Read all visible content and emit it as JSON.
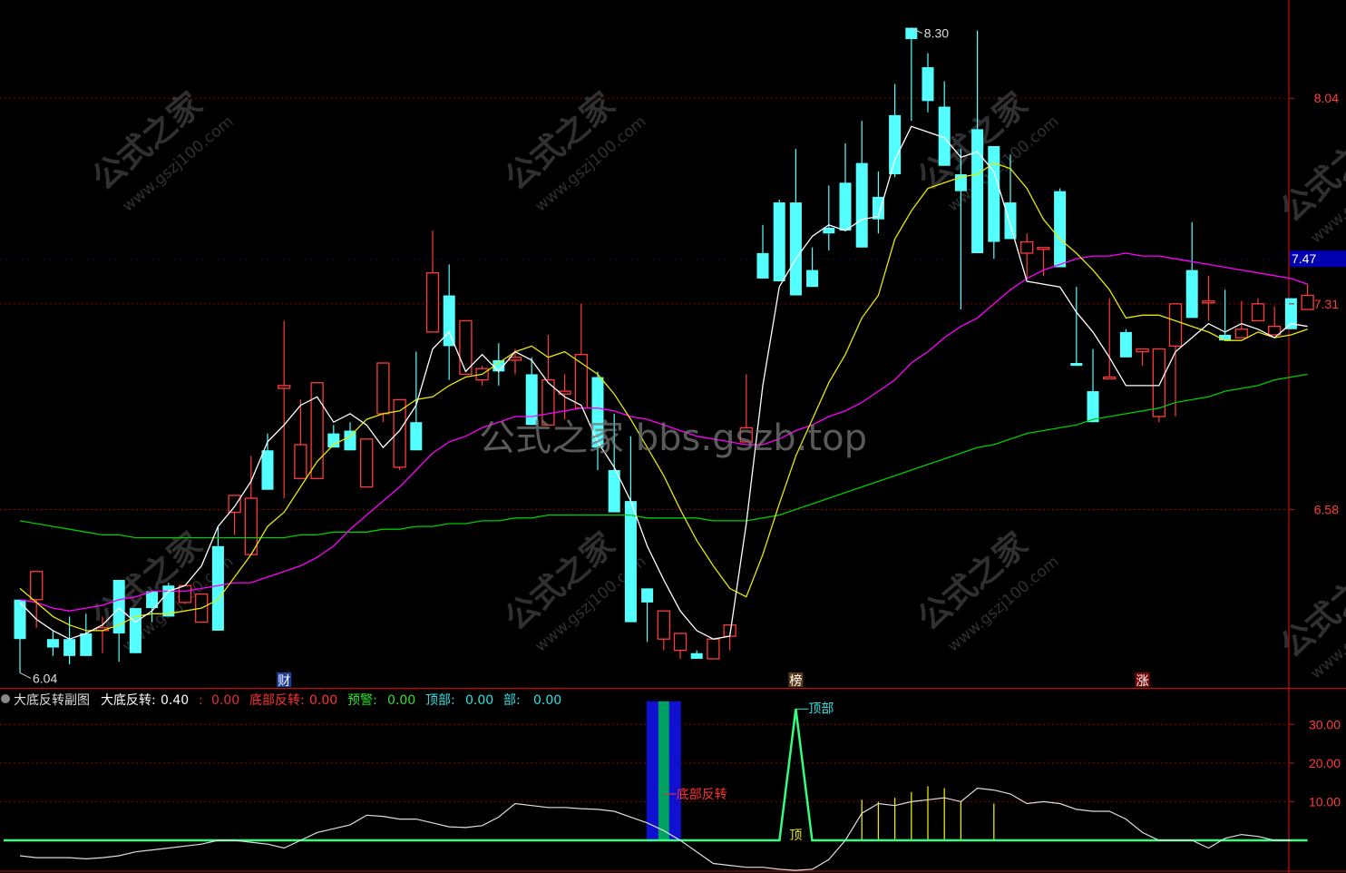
{
  "chart_data": {
    "type": "candlestick",
    "main": {
      "price_min": 5.95,
      "price_max": 8.35,
      "y_ticks": [
        "8.04",
        "7.31",
        "6.58"
      ],
      "current_price_label": "7.47",
      "high_marker": "8.30",
      "low_marker": "6.04",
      "candles": [
        [
          6.26,
          6.25,
          6.0,
          6.12
        ],
        [
          6.26,
          6.36,
          6.16,
          6.36
        ],
        [
          6.12,
          6.15,
          6.06,
          6.09
        ],
        [
          6.12,
          6.2,
          6.03,
          6.06
        ],
        [
          6.14,
          6.21,
          6.09,
          6.06
        ],
        [
          6.15,
          6.2,
          6.07,
          6.16
        ],
        [
          6.33,
          6.33,
          6.04,
          6.14
        ],
        [
          6.23,
          6.23,
          6.12,
          6.07
        ],
        [
          6.29,
          6.28,
          6.18,
          6.23
        ],
        [
          6.31,
          6.32,
          6.22,
          6.2
        ],
        [
          6.25,
          6.3,
          6.26,
          6.31
        ],
        [
          6.18,
          6.26,
          6.26,
          6.28
        ],
        [
          6.45,
          6.52,
          6.36,
          6.15
        ],
        [
          6.57,
          6.49,
          6.51,
          6.63
        ],
        [
          6.42,
          6.77,
          6.61,
          6.62
        ],
        [
          6.79,
          6.85,
          6.67,
          6.65
        ],
        [
          7.01,
          7.25,
          6.62,
          7.02
        ],
        [
          6.69,
          6.86,
          6.97,
          6.81
        ],
        [
          6.69,
          6.92,
          6.86,
          7.03
        ],
        [
          6.85,
          6.88,
          6.88,
          6.8
        ],
        [
          6.86,
          6.89,
          6.88,
          6.79
        ],
        [
          6.66,
          6.79,
          6.75,
          6.83
        ],
        [
          6.92,
          6.92,
          6.89,
          7.1
        ],
        [
          6.73,
          6.78,
          6.72,
          6.97
        ],
        [
          6.89,
          7.14,
          6.85,
          6.79
        ],
        [
          7.21,
          7.57,
          7.44,
          7.42
        ],
        [
          7.34,
          7.45,
          7.04,
          7.16
        ],
        [
          7.06,
          7.06,
          7.12,
          7.25
        ],
        [
          7.04,
          7.09,
          7.02,
          7.08
        ],
        [
          7.11,
          7.17,
          7.02,
          7.07
        ],
        [
          7.11,
          7.15,
          7.06,
          7.12
        ],
        [
          7.06,
          7.12,
          7.07,
          6.88
        ],
        [
          6.88,
          7.2,
          7.03,
          7.04
        ],
        [
          6.99,
          7.06,
          6.9,
          7.0
        ],
        [
          6.94,
          7.31,
          7.15,
          7.13
        ],
        [
          7.05,
          7.07,
          6.72,
          6.8
        ],
        [
          6.72,
          6.92,
          6.86,
          6.57
        ],
        [
          6.61,
          6.84,
          6.6,
          6.18
        ],
        [
          6.3,
          6.11,
          6.11,
          6.25
        ],
        [
          6.12,
          6.08,
          6.08,
          6.22
        ],
        [
          6.08,
          6.05,
          6.05,
          6.14
        ],
        [
          6.07,
          6.08,
          6.06,
          6.05
        ],
        [
          6.05,
          6.05,
          6.05,
          6.12
        ],
        [
          6.13,
          6.08,
          6.12,
          6.17
        ],
        [
          6.82,
          7.06,
          7.06,
          6.87
        ],
        [
          7.49,
          7.59,
          7.58,
          7.4
        ],
        [
          7.67,
          7.68,
          7.58,
          7.39
        ],
        [
          7.67,
          7.86,
          7.35,
          7.34
        ],
        [
          7.43,
          7.51,
          7.48,
          7.37
        ],
        [
          7.58,
          7.73,
          7.5,
          7.56
        ],
        [
          7.74,
          7.88,
          7.65,
          7.57
        ],
        [
          7.81,
          7.96,
          7.51,
          7.51
        ],
        [
          7.69,
          7.78,
          7.56,
          7.61
        ],
        [
          7.98,
          8.09,
          7.76,
          7.77
        ],
        [
          8.29,
          8.28,
          7.96,
          8.25
        ],
        [
          8.15,
          8.2,
          7.99,
          8.03
        ],
        [
          8.01,
          8.1,
          7.83,
          7.8
        ],
        [
          7.77,
          7.86,
          7.29,
          7.71
        ],
        [
          7.93,
          8.28,
          7.61,
          7.49
        ],
        [
          7.87,
          7.81,
          7.47,
          7.53
        ],
        [
          7.67,
          7.84,
          7.55,
          7.54
        ],
        [
          7.49,
          7.56,
          7.4,
          7.53
        ],
        [
          7.51,
          7.49,
          7.41,
          7.51
        ],
        [
          7.71,
          7.72,
          7.57,
          7.44
        ],
        [
          7.1,
          7.37,
          7.09,
          7.09
        ],
        [
          7.0,
          7.15,
          7.02,
          6.89
        ],
        [
          7.05,
          7.33,
          7.11,
          7.05
        ],
        [
          7.21,
          7.22,
          7.14,
          7.12
        ],
        [
          7.14,
          7.1,
          7.09,
          7.15
        ],
        [
          6.91,
          7.12,
          6.89,
          7.15
        ],
        [
          7.16,
          7.21,
          6.91,
          7.31
        ],
        [
          7.43,
          7.6,
          7.45,
          7.26
        ],
        [
          7.32,
          7.41,
          7.25,
          7.32
        ],
        [
          7.2,
          7.36,
          7.21,
          7.18
        ],
        [
          7.19,
          7.32,
          7.23,
          7.22
        ],
        [
          7.25,
          7.33,
          7.27,
          7.31
        ],
        [
          7.2,
          7.3,
          7.25,
          7.23
        ],
        [
          7.33,
          7.33,
          7.31,
          7.22
        ],
        [
          7.29,
          7.38,
          7.34,
          7.34
        ]
      ],
      "ma_white": [
        6.25,
        6.19,
        6.15,
        6.12,
        6.14,
        6.17,
        6.23,
        6.18,
        6.22,
        6.29,
        6.31,
        6.38,
        6.52,
        6.59,
        6.68,
        6.82,
        6.88,
        6.95,
        6.98,
        6.89,
        6.92,
        6.88,
        6.8,
        6.86,
        6.95,
        7.15,
        7.21,
        7.07,
        7.13,
        7.07,
        7.14,
        7.11,
        7.03,
        6.98,
        6.95,
        6.82,
        6.73,
        6.61,
        6.45,
        6.33,
        6.22,
        6.15,
        6.12,
        6.13,
        6.53,
        7.02,
        7.37,
        7.47,
        7.55,
        7.59,
        7.57,
        7.61,
        7.62,
        7.82,
        7.94,
        7.92,
        7.9,
        7.83,
        7.85,
        7.78,
        7.59,
        7.39,
        7.38,
        7.37,
        7.28,
        7.21,
        7.12,
        7.02,
        7.02,
        7.02,
        7.14,
        7.19,
        7.24,
        7.21,
        7.24,
        7.22,
        7.19,
        7.24,
        7.23
      ],
      "ma_yellow": [
        6.3,
        6.25,
        6.2,
        6.17,
        6.15,
        6.15,
        6.17,
        6.2,
        6.21,
        6.21,
        6.22,
        6.23,
        6.26,
        6.34,
        6.42,
        6.52,
        6.57,
        6.66,
        6.75,
        6.81,
        6.84,
        6.9,
        6.92,
        6.93,
        6.97,
        6.98,
        7.02,
        7.05,
        7.06,
        7.1,
        7.14,
        7.16,
        7.12,
        7.14,
        7.1,
        7.06,
        6.99,
        6.9,
        6.8,
        6.7,
        6.58,
        6.47,
        6.38,
        6.3,
        6.27,
        6.42,
        6.6,
        6.77,
        6.9,
        7.03,
        7.13,
        7.26,
        7.34,
        7.54,
        7.64,
        7.72,
        7.74,
        7.76,
        7.77,
        7.81,
        7.79,
        7.72,
        7.61,
        7.54,
        7.49,
        7.43,
        7.36,
        7.26,
        7.27,
        7.27,
        7.25,
        7.23,
        7.21,
        7.18,
        7.18,
        7.21,
        7.19,
        7.2,
        7.22
      ],
      "ma_magenta": [
        6.26,
        6.25,
        6.23,
        6.22,
        6.23,
        6.24,
        6.26,
        6.27,
        6.29,
        6.29,
        6.29,
        6.3,
        6.31,
        6.32,
        6.32,
        6.34,
        6.36,
        6.38,
        6.41,
        6.45,
        6.51,
        6.56,
        6.61,
        6.66,
        6.72,
        6.78,
        6.82,
        6.84,
        6.87,
        6.89,
        6.91,
        6.91,
        6.92,
        6.93,
        6.94,
        6.94,
        6.93,
        6.91,
        6.9,
        6.88,
        6.86,
        6.84,
        6.83,
        6.82,
        6.81,
        6.81,
        6.83,
        6.86,
        6.88,
        6.91,
        6.93,
        6.96,
        7.0,
        7.04,
        7.1,
        7.14,
        7.19,
        7.23,
        7.26,
        7.31,
        7.36,
        7.4,
        7.43,
        7.45,
        7.47,
        7.48,
        7.48,
        7.49,
        7.48,
        7.48,
        7.47,
        7.46,
        7.45,
        7.44,
        7.43,
        7.42,
        7.41,
        7.4,
        7.38
      ],
      "ma_green": [
        6.54,
        6.53,
        6.52,
        6.51,
        6.5,
        6.49,
        6.49,
        6.48,
        6.48,
        6.48,
        6.48,
        6.48,
        6.48,
        6.48,
        6.48,
        6.48,
        6.48,
        6.49,
        6.49,
        6.5,
        6.5,
        6.5,
        6.51,
        6.51,
        6.52,
        6.52,
        6.53,
        6.53,
        6.54,
        6.54,
        6.55,
        6.55,
        6.56,
        6.56,
        6.56,
        6.56,
        6.56,
        6.56,
        6.55,
        6.55,
        6.55,
        6.55,
        6.54,
        6.54,
        6.54,
        6.55,
        6.56,
        6.58,
        6.6,
        6.62,
        6.64,
        6.66,
        6.68,
        6.7,
        6.72,
        6.74,
        6.76,
        6.78,
        6.8,
        6.81,
        6.83,
        6.85,
        6.86,
        6.87,
        6.88,
        6.9,
        6.91,
        6.92,
        6.93,
        6.94,
        6.96,
        6.97,
        6.98,
        7.0,
        7.01,
        7.02,
        7.04,
        7.05,
        7.06
      ],
      "event_labels": [
        {
          "index": 16,
          "text": "财"
        },
        {
          "index": 47,
          "text": "榜"
        },
        {
          "index": 68,
          "text": "涨"
        }
      ]
    },
    "sub": {
      "title": "大底反转副图",
      "params": [
        {
          "label": "大底反转: ",
          "value": "0.40",
          "color": "#ffffff"
        },
        {
          "label": ": ",
          "value": "0.00",
          "color": "#e03030"
        },
        {
          "label": "底部反转: ",
          "value": "0.00",
          "color": "#ff3030"
        },
        {
          "label": "预警: ",
          "value": "0.00",
          "color": "#30e030"
        },
        {
          "label": "顶部: ",
          "value": "0.00",
          "color": "#30e0e0"
        },
        {
          "label": "部: ",
          "value": "0.00",
          "color": "#30e0e0"
        }
      ],
      "y_min": -8,
      "y_max": 39,
      "y_ticks": [
        "30.00",
        "20.00",
        "10.00"
      ],
      "y_tick_values": [
        30,
        20,
        10
      ],
      "line_white": [
        -4,
        -4.5,
        -4.5,
        -4.5,
        -4.8,
        -4.5,
        -4,
        -3,
        -2.5,
        -2,
        -1.5,
        -1,
        0,
        0,
        -0.5,
        -1,
        -2,
        0,
        2,
        3,
        4,
        6.5,
        6.2,
        5.5,
        5.5,
        4.5,
        3.5,
        3.3,
        3.8,
        6,
        9.5,
        9,
        8.5,
        8.5,
        8.2,
        8,
        7.5,
        6,
        4.5,
        2.5,
        0,
        -3,
        -6,
        -6.5,
        -7,
        -7,
        -7.5,
        -7.8,
        -7.5,
        -5,
        0,
        7,
        9.5,
        9,
        10,
        10.5,
        11,
        10,
        13.5,
        13,
        12,
        9.5,
        10,
        9.5,
        8,
        7.5,
        7.5,
        5.5,
        2,
        0,
        0,
        0,
        -2,
        0.5,
        1.5,
        1,
        0,
        0
      ],
      "line_green_level": 0,
      "bottom_reversal_label": "底部反转",
      "bottom_reversal_index": 39,
      "top_peak_label": "顶部",
      "top_peak_index": 47,
      "top_peak_value": 34,
      "top_base_label": "顶",
      "yellow_bars": [
        {
          "index": 51,
          "value": 10.5
        },
        {
          "index": 52,
          "value": 10
        },
        {
          "index": 53,
          "value": 11
        },
        {
          "index": 54,
          "value": 12.5
        },
        {
          "index": 55,
          "value": 14
        },
        {
          "index": 56,
          "value": 13.5
        },
        {
          "index": 57,
          "value": 10
        },
        {
          "index": 59,
          "value": 9.5
        }
      ]
    },
    "top_header": "",
    "watermarks": {
      "center": "公式之家 bbs.gszb.top",
      "tile_main": "公式之家",
      "tile_sub": "www.gszj100.com"
    }
  },
  "colors": {
    "background": "#000000",
    "up": "#ff3b3b",
    "down": "#54ffff",
    "ma_white": "#ffffff",
    "ma_yellow": "#e8e800",
    "ma_magenta": "#ff00ff",
    "ma_green": "#00cc00",
    "grid": "#8b0000",
    "axis_text": "#ff3b3b",
    "price_box": "#0000b0",
    "bar_blue": "#1010d0",
    "bar_green": "#00a060"
  }
}
